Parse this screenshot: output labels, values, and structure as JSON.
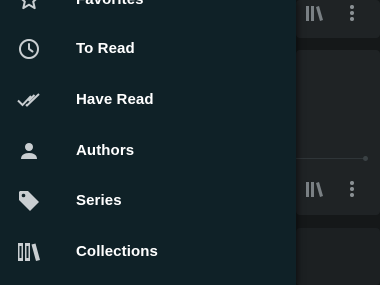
{
  "drawer": {
    "items": [
      {
        "label": "Favorites",
        "icon": "star-outline-icon"
      },
      {
        "label": "To Read",
        "icon": "clock-icon"
      },
      {
        "label": "Have Read",
        "icon": "double-check-icon"
      },
      {
        "label": "Authors",
        "icon": "person-icon"
      },
      {
        "label": "Series",
        "icon": "tag-icon"
      },
      {
        "label": "Collections",
        "icon": "library-icon"
      }
    ]
  },
  "colors": {
    "drawer_background": "#0f2127",
    "icon_tint": "#c9ced1",
    "text": "#ffffff"
  }
}
